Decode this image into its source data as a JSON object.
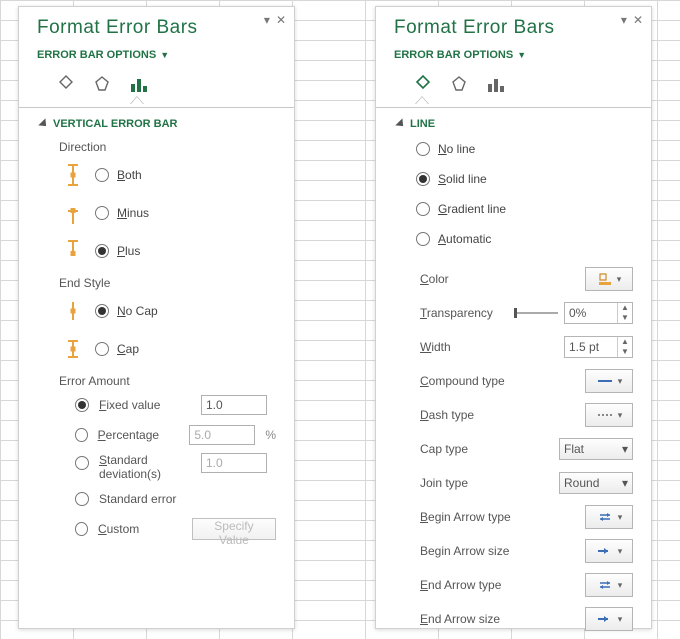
{
  "left": {
    "title": "Format Error Bars",
    "subtitle": "ERROR BAR OPTIONS",
    "section": "VERTICAL ERROR BAR",
    "direction": {
      "label": "Direction",
      "options": {
        "both": {
          "label": "Both",
          "key": "B",
          "selected": false
        },
        "minus": {
          "label": "Minus",
          "key": "M",
          "selected": false
        },
        "plus": {
          "label": "Plus",
          "key": "P",
          "selected": true
        }
      }
    },
    "end_style": {
      "label": "End Style",
      "options": {
        "nocap": {
          "label": "No Cap",
          "key": "N",
          "selected": true
        },
        "cap": {
          "label": "Cap",
          "key": "C",
          "selected": false
        }
      }
    },
    "error_amount": {
      "label": "Error Amount",
      "fixed": {
        "label": "Fixed value",
        "key": "F",
        "value": "1.0",
        "selected": true
      },
      "percent": {
        "label": "Percentage",
        "key": "P",
        "value": "5.0",
        "unit": "%",
        "selected": false
      },
      "stddev": {
        "label": "Standard deviation(s)",
        "key": "S",
        "value": "1.0",
        "selected": false
      },
      "stderr": {
        "label": "Standard error",
        "selected": false
      },
      "custom": {
        "label": "Custom",
        "key": "C",
        "button": "Specify Value",
        "selected": false
      }
    }
  },
  "right": {
    "title": "Format Error Bars",
    "subtitle": "ERROR BAR OPTIONS",
    "section": "LINE",
    "line": {
      "none": {
        "label": "No line",
        "key": "N",
        "selected": false
      },
      "solid": {
        "label": "Solid line",
        "key": "S",
        "selected": true
      },
      "gradient": {
        "label": "Gradient line",
        "key": "G",
        "selected": false
      },
      "auto": {
        "label": "Automatic",
        "key": "A",
        "selected": false
      }
    },
    "props": {
      "color": {
        "label": "Color",
        "key": "C"
      },
      "transparency": {
        "label": "Transparency",
        "key": "T",
        "value": "0%"
      },
      "width": {
        "label": "Width",
        "key": "W",
        "value": "1.5 pt"
      },
      "compound": {
        "label": "Compound type",
        "key": "C"
      },
      "dash": {
        "label": "Dash type",
        "key": "D"
      },
      "captype": {
        "label": "Cap type",
        "value": "Flat"
      },
      "jointype": {
        "label": "Join type",
        "value": "Round"
      },
      "beginArrowT": {
        "label": "Begin Arrow type",
        "key": "B"
      },
      "beginArrowS": {
        "label": "Begin Arrow size"
      },
      "endArrowT": {
        "label": "End Arrow type",
        "key": "E"
      },
      "endArrowS": {
        "label": "End Arrow size",
        "key": "E"
      }
    }
  }
}
